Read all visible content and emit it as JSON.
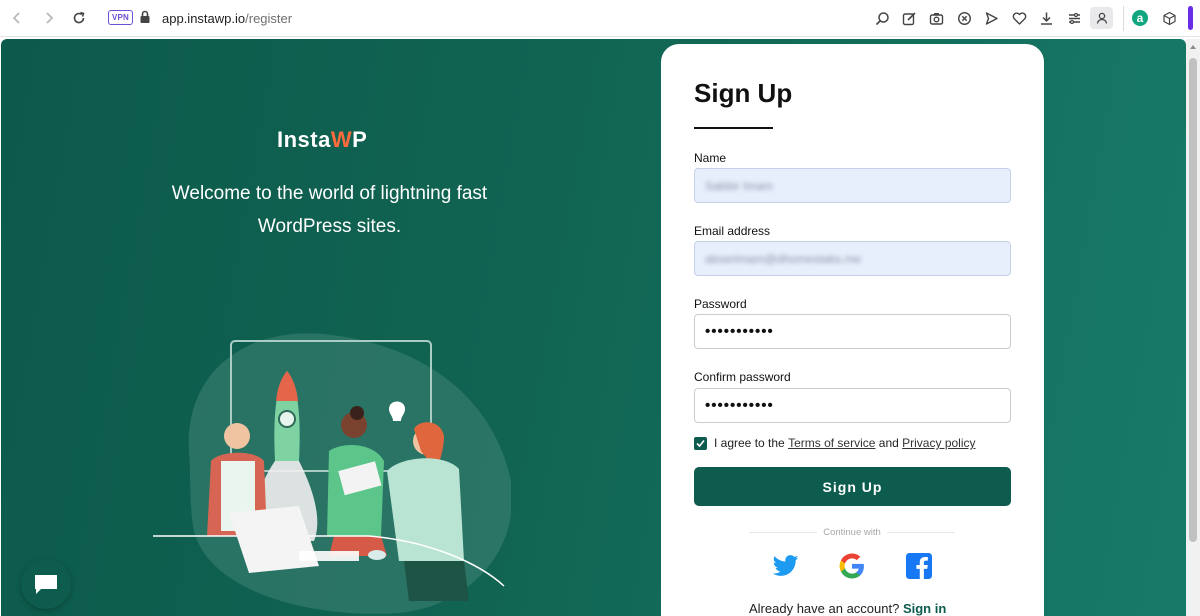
{
  "browser": {
    "vpn_label": "VPN",
    "url_host": "app.instawp.io",
    "url_path": "/register"
  },
  "brand": {
    "logo_text_1": "Insta",
    "logo_text_2": "W",
    "logo_text_3": "P",
    "welcome_line1": "Welcome to the world of lightning fast",
    "welcome_line2": "WordPress sites."
  },
  "form": {
    "title": "Sign Up",
    "name_label": "Name",
    "name_value": "Sabbir Imam",
    "email_label": "Email address",
    "email_value": "abserimam@dhomestaks.me",
    "password_label": "Password",
    "password_value": "•••••••••••",
    "confirm_label": "Confirm password",
    "confirm_value": "•••••••••••",
    "agree_prefix": "I agree to the",
    "terms_link": "Terms of service",
    "agree_and": "and",
    "privacy_link": "Privacy policy",
    "submit_label": "Sign Up",
    "continue_with": "Continue with",
    "have_account": "Already have an account?",
    "signin_link": "Sign in"
  },
  "colors": {
    "brand_green": "#0d5c4e",
    "accent_orange": "#ff6b3d",
    "autofill_bg": "#e8effc"
  }
}
